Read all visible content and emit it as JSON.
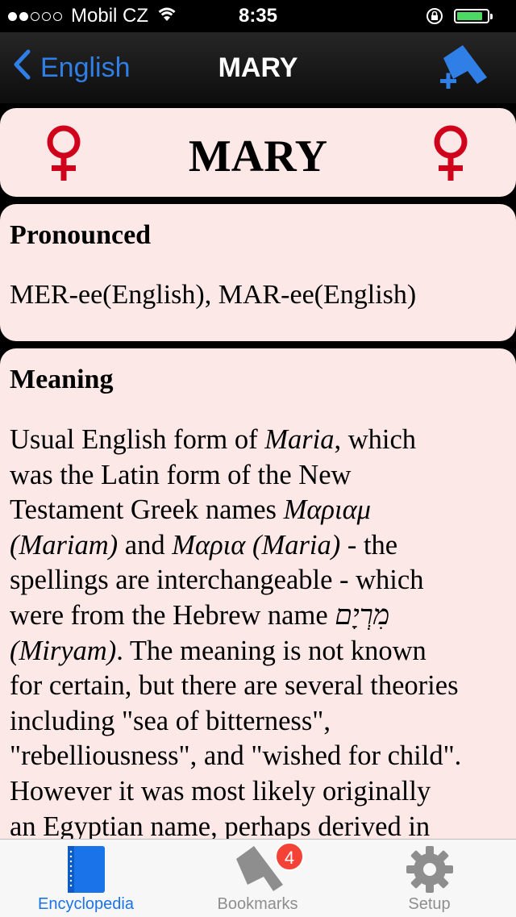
{
  "status_bar": {
    "carrier": "Mobil CZ",
    "time": "8:35",
    "signal_bars_filled": 2,
    "signal_bars_total": 5,
    "battery_level": 0.85
  },
  "nav": {
    "back_label": "English",
    "title": "MARY",
    "add_bookmark_icon": "bookmark-plus-icon"
  },
  "name_card": {
    "name": "MARY",
    "gender_icon": "female-symbol-icon",
    "gender_color": "#d0021b"
  },
  "pronounced": {
    "heading": "Pronounced",
    "text": "MER-ee(English), MAR-ee(English)"
  },
  "meaning": {
    "heading": "Meaning",
    "lines": [
      [
        {
          "t": "Usual English form of "
        },
        {
          "t": "Maria",
          "i": true
        },
        {
          "t": ", which"
        }
      ],
      [
        {
          "t": "was the Latin form of the New"
        }
      ],
      [
        {
          "t": "Testament Greek names "
        },
        {
          "t": "Μαριαμ",
          "i": true
        }
      ],
      [
        {
          "t": "(Mariam)",
          "i": true
        },
        {
          "t": " and "
        },
        {
          "t": "Μαρια (Maria)",
          "i": true
        },
        {
          "t": " - the"
        }
      ],
      [
        {
          "t": "spellings are interchangeable - which"
        }
      ],
      [
        {
          "t": "were from the Hebrew name "
        },
        {
          "t": "מִרְיָם",
          "i": true
        }
      ],
      [
        {
          "t": "(Miryam)",
          "i": true
        },
        {
          "t": ". The meaning is not known"
        }
      ],
      [
        {
          "t": "for certain, but there are several theories"
        }
      ],
      [
        {
          "t": "including \"sea of bitterness\","
        }
      ],
      [
        {
          "t": "\"rebelliousness\", and \"wished for child\"."
        }
      ],
      [
        {
          "t": "However it was most likely originally"
        }
      ],
      [
        {
          "t": "an Egyptian name, perhaps derived in"
        }
      ]
    ]
  },
  "tabs": [
    {
      "label": "Encyclopedia",
      "icon": "book-icon",
      "active": true
    },
    {
      "label": "Bookmarks",
      "icon": "bookmark-icon",
      "active": false,
      "badge": "4"
    },
    {
      "label": "Setup",
      "icon": "gear-icon",
      "active": false
    }
  ],
  "colors": {
    "accent": "#2f7fe6",
    "card_background": "#fde8e8",
    "badge": "#f44336",
    "inactive_tab": "#8e8e8e"
  }
}
